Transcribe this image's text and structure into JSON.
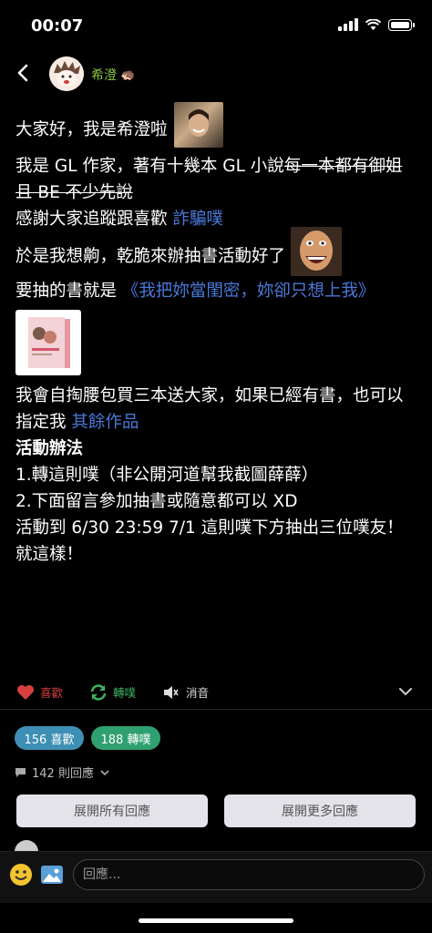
{
  "status": {
    "time": "00:07"
  },
  "header": {
    "author": "希澄",
    "author_emoji": "🦔"
  },
  "post": {
    "l1": "大家好，我是希澄啦",
    "l2a": "我是 GL 作家，著有十幾本 GL 小說",
    "l2b": "每一本都有御姐且 BE 不少先說",
    "l3a": "感謝大家追蹤跟喜歡",
    "l3b": "詐騙噗",
    "l4": "於是我想齁，乾脆來辦抽書活動好了",
    "l5a": "要抽的書就是",
    "l5b": "《我把妳當閨密，妳卻只想上我》",
    "l6a": "我會自掏腰包買三本送大家，如果已經有書，也可以指定我",
    "l6b": "其餘作品",
    "l7": "活動辦法",
    "l8": "1.轉這則噗（非公開河道幫我截圖薛薛）",
    "l9": "2.下面留言參加抽書或隨意都可以 XD",
    "l10": "活動到 6/30 23:59 7/1 這則噗下方抽出三位噗友！",
    "l11": "就這樣！"
  },
  "actions": {
    "like": "喜歡",
    "replurk": "轉噗",
    "mute": "消音"
  },
  "stats": {
    "likes": "156 喜歡",
    "replurks": "188 轉噗",
    "responses": "142 則回應"
  },
  "buttons": {
    "expand_all": "展開所有回應",
    "expand_more": "展開更多回應"
  },
  "reply": {
    "placeholder": "回應..."
  },
  "colors": {
    "link": "#4a78d8",
    "author": "#8cc63f",
    "like": "#d64040",
    "replurk": "#3fae5f"
  }
}
